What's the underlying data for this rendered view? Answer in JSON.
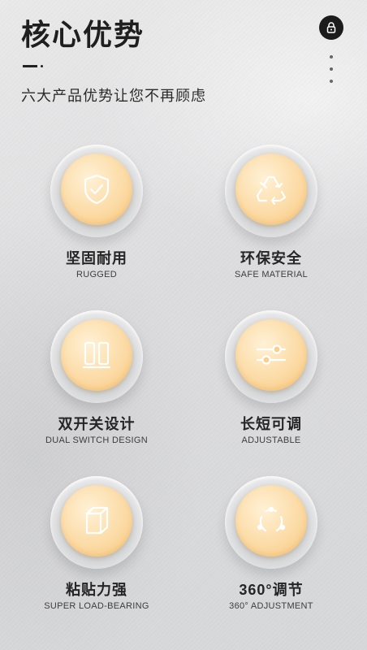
{
  "header": {
    "title": "核心优势",
    "subtitle": "六大产品优势让您不再顾虑",
    "lock_icon": "lock-icon",
    "more_icon": "vertical-dots-icon"
  },
  "colors": {
    "accent_disc": "#fbd9a2",
    "icon_stroke": "#ffffff",
    "text_dark": "#1f1f1f"
  },
  "features": [
    {
      "cn": "坚固耐用",
      "en": "RUGGED",
      "icon": "shield-check-icon"
    },
    {
      "cn": "环保安全",
      "en": "SAFE MATERIAL",
      "icon": "recycle-icon"
    },
    {
      "cn": "双开关设计",
      "en": "DUAL SWITCH DESIGN",
      "icon": "dual-switch-icon"
    },
    {
      "cn": "长短可调",
      "en": "ADJUSTABLE",
      "icon": "sliders-icon"
    },
    {
      "cn": "粘贴力强",
      "en": "SUPER LOAD-BEARING",
      "icon": "cube-icon"
    },
    {
      "cn": "360°调节",
      "en": "360° ADJUSTMENT",
      "icon": "rotation-icon"
    }
  ]
}
